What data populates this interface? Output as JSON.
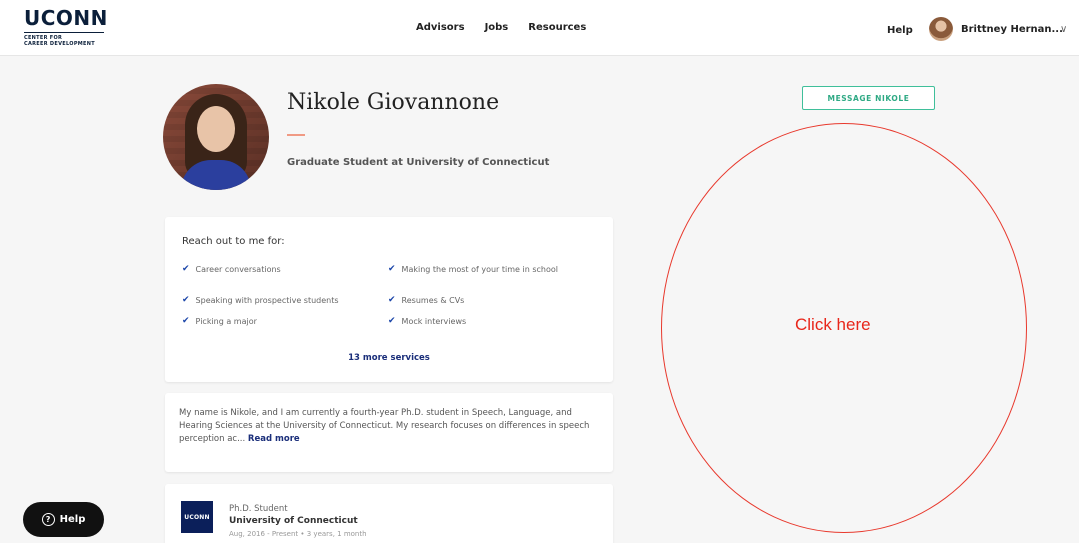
{
  "header": {
    "logo": {
      "main": "UCONN",
      "sub_line1": "CENTER FOR",
      "sub_line2": "CAREER DEVELOPMENT"
    },
    "nav": [
      "Advisors",
      "Jobs",
      "Resources"
    ],
    "help": "Help",
    "user_name": "Brittney Hernan...",
    "chevron": "∨"
  },
  "profile": {
    "name": "Nikole Giovannone",
    "title": "Graduate Student at University of Connecticut",
    "message_button": "MESSAGE NIKOLE"
  },
  "services": {
    "heading": "Reach out to me for:",
    "items": [
      "Career conversations",
      "Making the most of your time in school",
      "Speaking with prospective students",
      "Resumes & CVs",
      "Picking a major",
      "Mock interviews"
    ],
    "more": "13 more services"
  },
  "about": {
    "text": "My name is Nikole, and I am currently a fourth-year Ph.D. student in Speech, Language, and Hearing Sciences at the University of Connecticut. My research focuses on differences in speech perception ac...",
    "read_more": "Read more"
  },
  "education": {
    "logo_text": "UCONN",
    "degree": "Ph.D. Student",
    "school": "University of Connecticut",
    "dates": "Aug, 2016 - Present • 3 years, 1 month"
  },
  "help_fab": {
    "icon": "?",
    "label": "Help"
  },
  "annotation": {
    "text": "Click here",
    "color": "#e8261a"
  },
  "colors": {
    "accent_green": "#2ea984",
    "link_blue": "#1a2e7a",
    "check_blue": "#1a44a8",
    "underline_salmon": "#f09a84"
  }
}
